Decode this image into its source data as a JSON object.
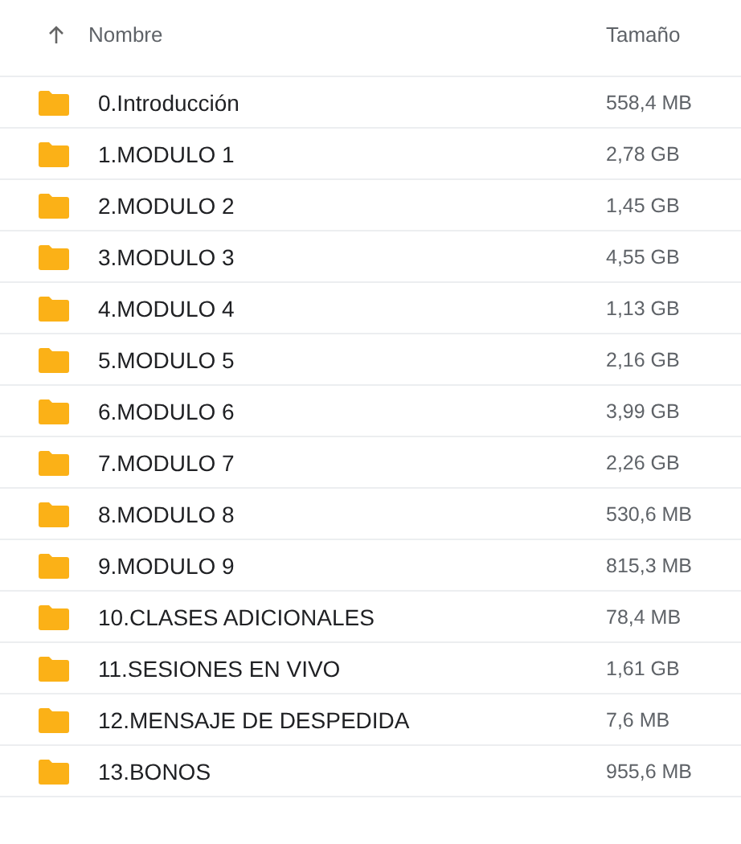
{
  "header": {
    "name_label": "Nombre",
    "size_label": "Tamaño"
  },
  "rows": [
    {
      "name": "0.Introducción",
      "size": "558,4 MB"
    },
    {
      "name": "1.MODULO 1",
      "size": "2,78 GB"
    },
    {
      "name": "2.MODULO 2",
      "size": "1,45 GB"
    },
    {
      "name": "3.MODULO 3",
      "size": "4,55 GB"
    },
    {
      "name": "4.MODULO 4",
      "size": "1,13 GB"
    },
    {
      "name": "5.MODULO 5",
      "size": "2,16 GB"
    },
    {
      "name": "6.MODULO 6",
      "size": "3,99 GB"
    },
    {
      "name": "7.MODULO 7",
      "size": "2,26 GB"
    },
    {
      "name": "8.MODULO 8",
      "size": "530,6 MB"
    },
    {
      "name": "9.MODULO 9",
      "size": "815,3 MB"
    },
    {
      "name": "10.CLASES ADICIONALES",
      "size": "78,4 MB"
    },
    {
      "name": "11.SESIONES EN VIVO",
      "size": "1,61 GB"
    },
    {
      "name": "12.MENSAJE DE DESPEDIDA",
      "size": "7,6 MB"
    },
    {
      "name": "13.BONOS",
      "size": "955,6 MB"
    }
  ]
}
